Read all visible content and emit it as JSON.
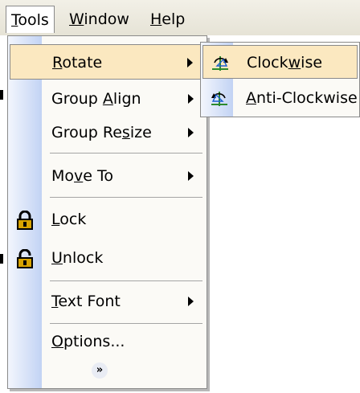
{
  "menubar": {
    "items": [
      {
        "label": "Tools"
      },
      {
        "label": "Window"
      },
      {
        "label": "Help"
      }
    ]
  },
  "tools_menu": {
    "items": [
      {
        "label": "Rotate",
        "mnemonic_index": 0,
        "has_submenu": true
      },
      {
        "label": "Group Align",
        "mnemonic_index": 6,
        "has_submenu": true
      },
      {
        "label": "Group Resize",
        "mnemonic_index": 8,
        "has_submenu": true
      },
      {
        "label": "Move To",
        "mnemonic_index": 2,
        "has_submenu": true
      },
      {
        "label": "Lock",
        "mnemonic_index": 0,
        "icon": "lock-icon"
      },
      {
        "label": "Unlock",
        "mnemonic_index": 0,
        "icon": "unlock-icon"
      },
      {
        "label": "Text Font",
        "mnemonic_index": 0,
        "has_submenu": true
      },
      {
        "label": "Options...",
        "mnemonic_index": 0
      }
    ],
    "expand_icon": "chevron-double-down-icon"
  },
  "rotate_submenu": {
    "items": [
      {
        "label": "Clockwise",
        "mnemonic_index": 5,
        "icon": "rotate-clockwise-icon"
      },
      {
        "label": "Anti-Clockwise",
        "mnemonic_index": 0,
        "icon": "rotate-anticlockwise-icon"
      }
    ]
  },
  "colors": {
    "highlight": "#fbe8c0",
    "gutter_start": "#f3f6fd",
    "gutter_end": "#c2d3f4",
    "menu_bg": "#fbfaf6",
    "lock_gold": "#d9a400"
  }
}
